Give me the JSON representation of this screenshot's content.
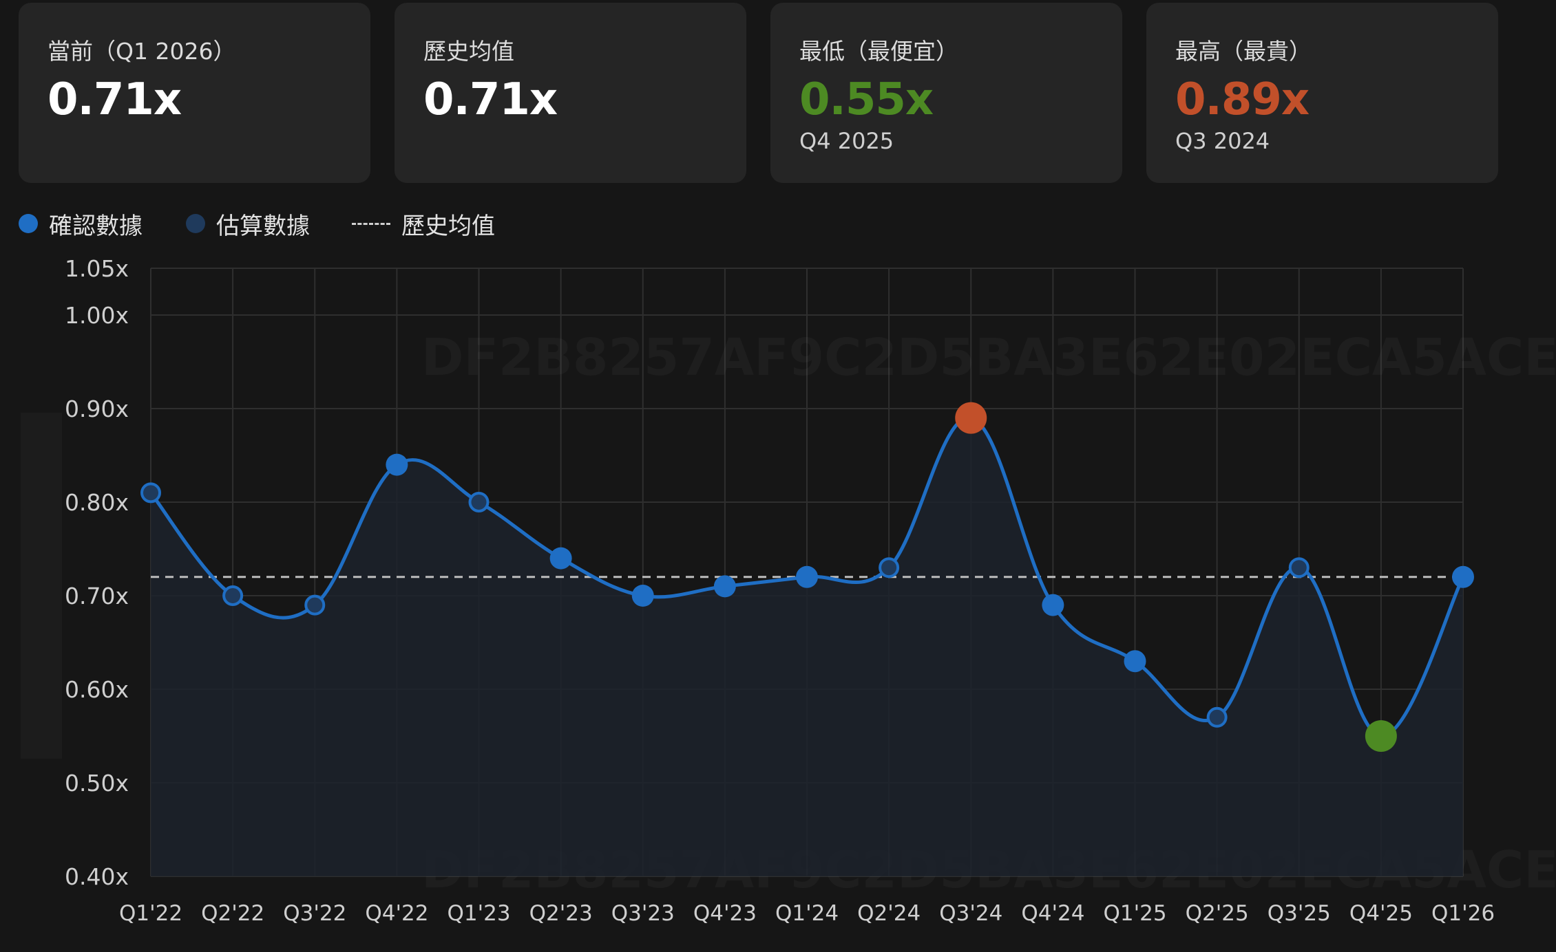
{
  "cards": [
    {
      "label": "當前（Q1 2026）",
      "value": "0.71x",
      "sub": "",
      "color": "#ffffff"
    },
    {
      "label": "歷史均值",
      "value": "0.71x",
      "sub": "",
      "color": "#ffffff"
    },
    {
      "label": "最低（最便宜）",
      "value": "0.55x",
      "sub": "Q4 2025",
      "color": "#4d8a23"
    },
    {
      "label": "最高（最貴）",
      "value": "0.89x",
      "sub": "Q3 2024",
      "color": "#c2502a"
    }
  ],
  "legend": {
    "confirmed": "確認數據",
    "estimated": "估算數據",
    "average": "歷史均值"
  },
  "watermark": "DF2B8257AF9C2D5BA3E62E02ECA5ACE",
  "colors": {
    "confirmed": "#1f6ec4",
    "estimated": "#1f3a5c",
    "min_point": "#4d8a23",
    "max_point": "#c2502a",
    "average_line": "#bdbdbd"
  },
  "chart_data": {
    "type": "line",
    "categories": [
      "Q1'22",
      "Q2'22",
      "Q3'22",
      "Q4'22",
      "Q1'23",
      "Q2'23",
      "Q3'23",
      "Q4'23",
      "Q1'24",
      "Q2'24",
      "Q3'24",
      "Q4'24",
      "Q1'25",
      "Q2'25",
      "Q3'25",
      "Q4'25",
      "Q1'26"
    ],
    "series": [
      {
        "name": "確認數據",
        "values": [
          0.81,
          0.7,
          0.69,
          0.84,
          0.8,
          0.74,
          0.7,
          0.71,
          0.72,
          0.73,
          0.89,
          0.69,
          0.63,
          0.57,
          0.73,
          0.55,
          0.72
        ],
        "estimated": [
          true,
          true,
          true,
          false,
          true,
          false,
          false,
          false,
          false,
          true,
          false,
          false,
          false,
          true,
          true,
          false,
          false
        ]
      }
    ],
    "average": 0.72,
    "min_index": 15,
    "max_index": 10,
    "yticks": [
      0.4,
      0.5,
      0.6,
      0.7,
      0.8,
      0.9,
      1.0,
      1.05
    ],
    "ytick_labels": [
      "0.40x",
      "0.50x",
      "0.60x",
      "0.70x",
      "0.80x",
      "0.90x",
      "1.00x",
      "1.05x"
    ],
    "ylim": [
      0.4,
      1.05
    ],
    "grid": true,
    "legend": "top-left"
  }
}
